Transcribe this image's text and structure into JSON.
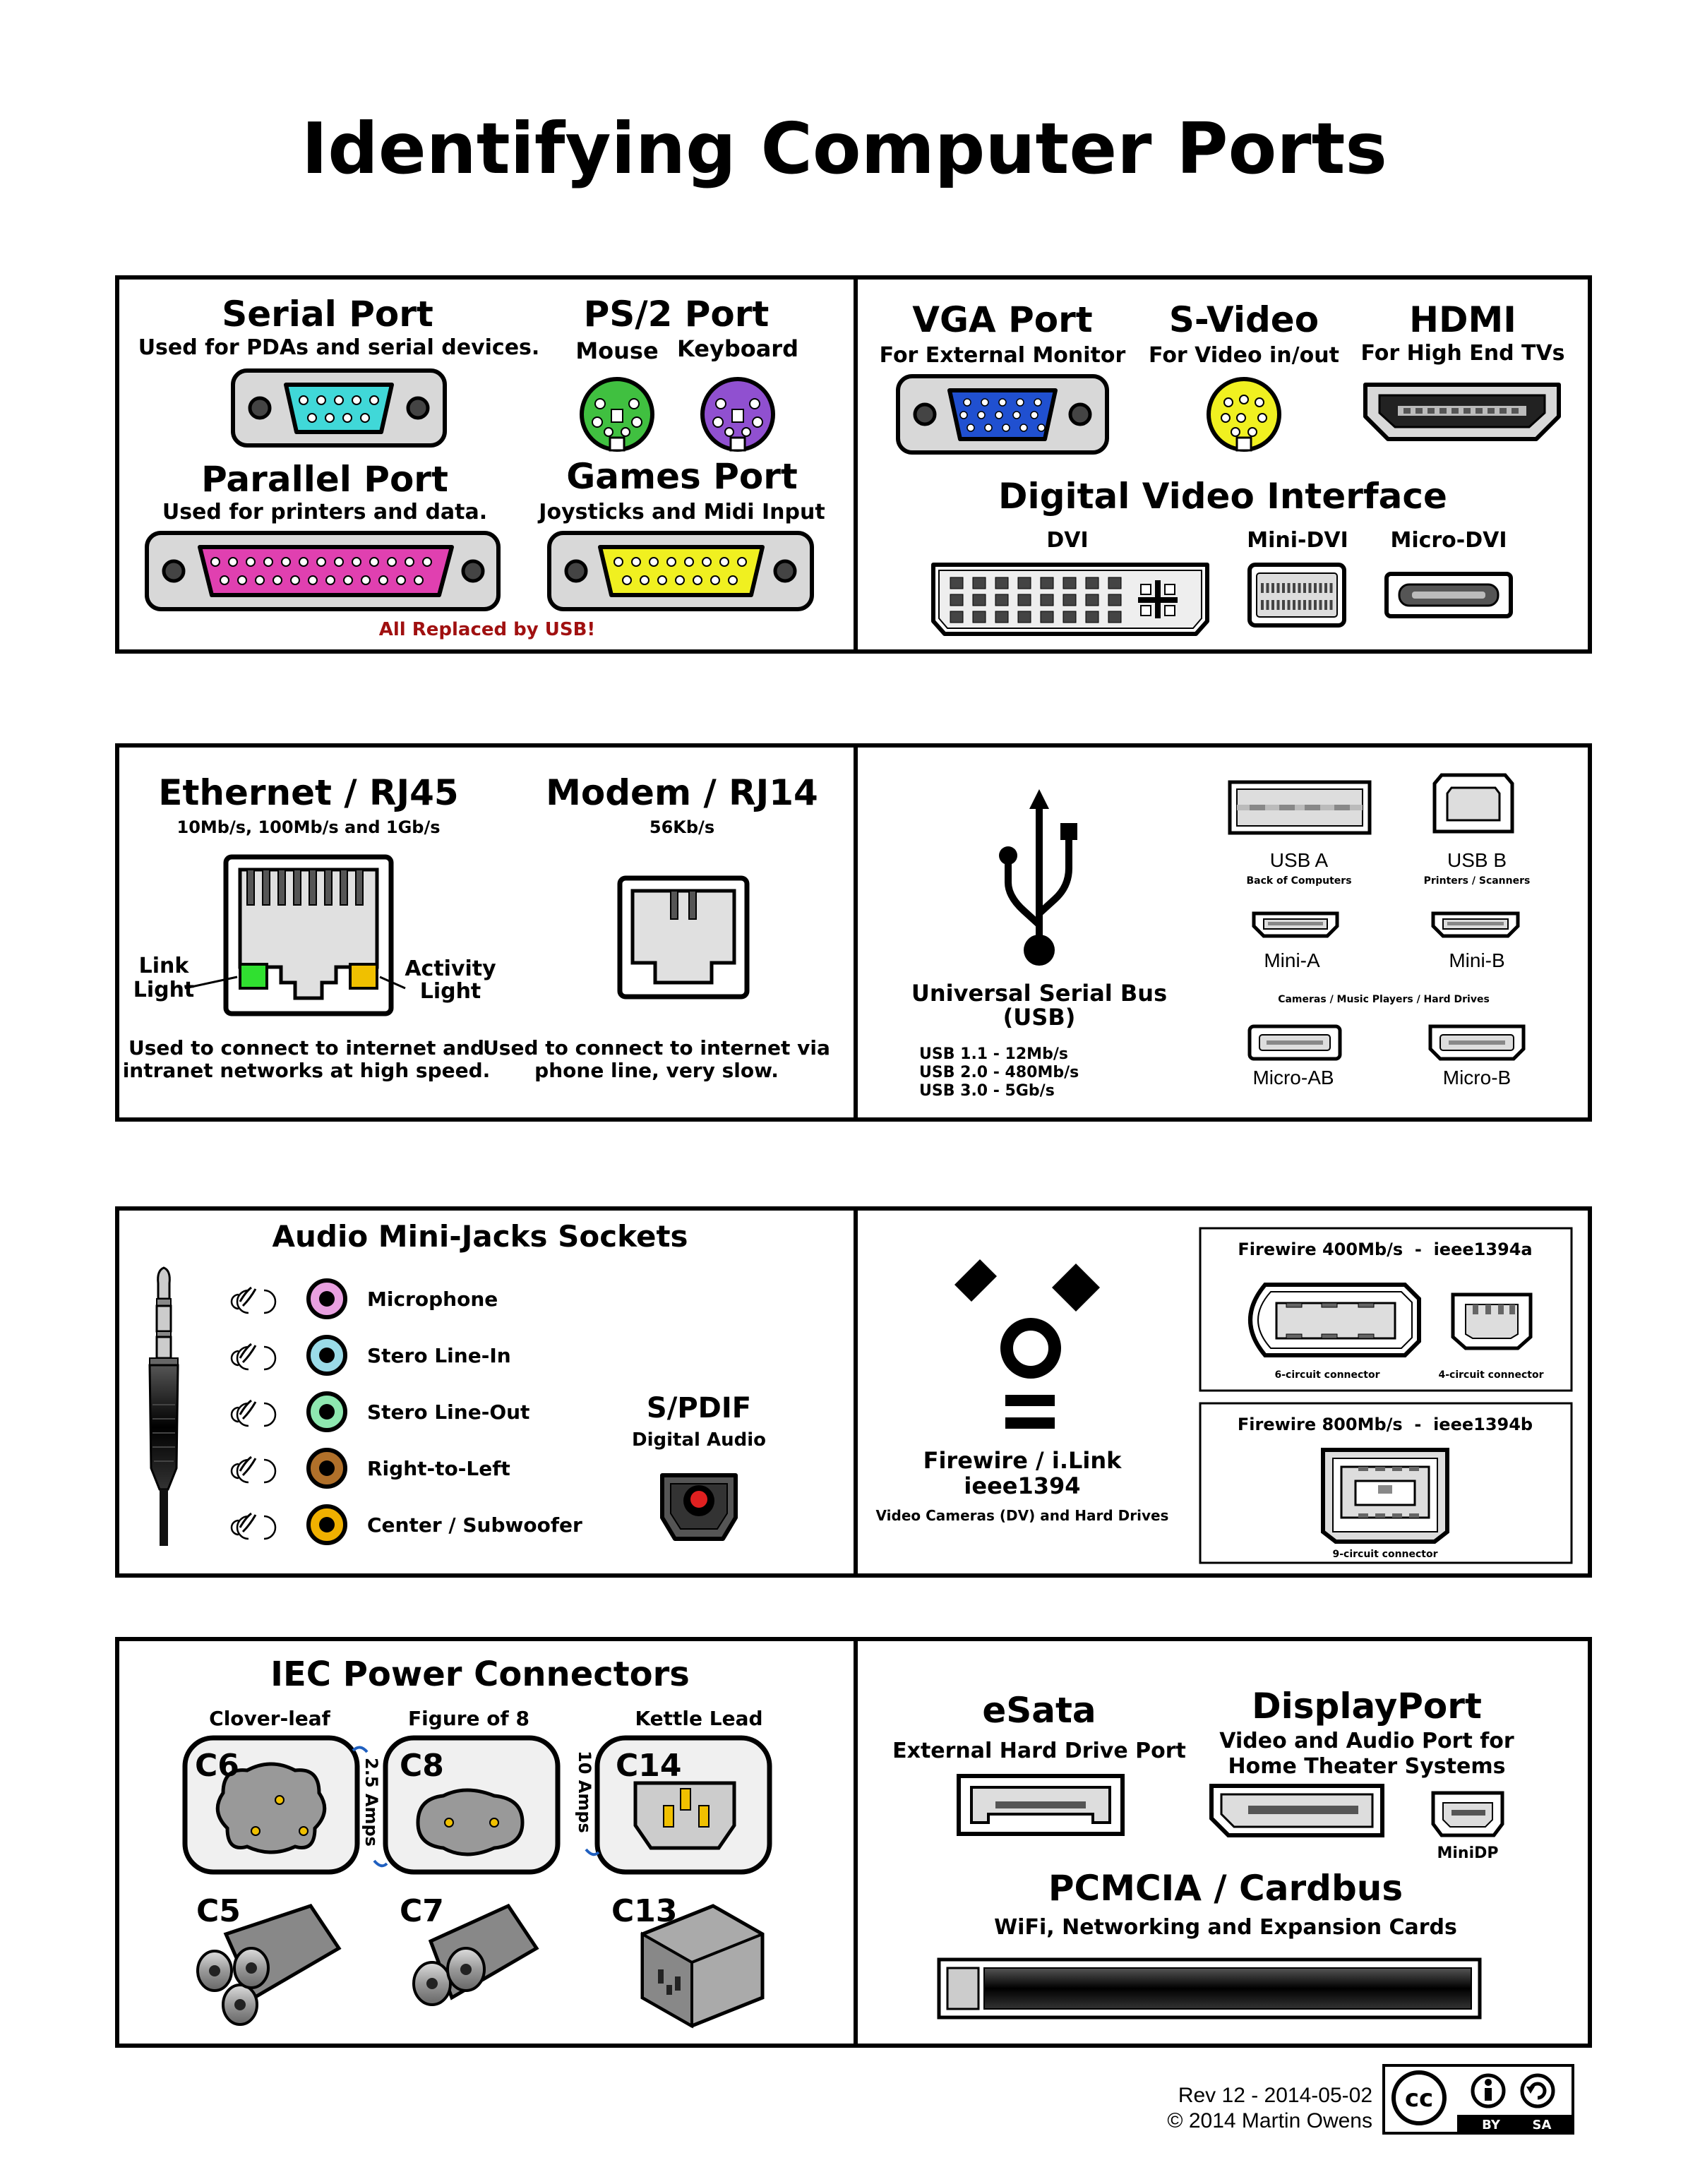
{
  "title": "Identifying Computer Ports",
  "legacy": {
    "serial": {
      "title": "Serial Port",
      "desc": "Used for PDAs and serial devices."
    },
    "ps2": {
      "title": "PS/2 Port",
      "mouse": "Mouse",
      "keyboard": "Keyboard"
    },
    "parallel": {
      "title": "Parallel Port",
      "desc": "Used for printers and data."
    },
    "games": {
      "title": "Games Port",
      "desc": "Joysticks and Midi Input"
    },
    "note": "All Replaced by USB!"
  },
  "video": {
    "vga": {
      "title": "VGA Port",
      "desc": "For External Monitor"
    },
    "svideo": {
      "title": "S-Video",
      "desc": "For Video in/out"
    },
    "hdmi": {
      "title": "HDMI",
      "desc": "For High End TVs"
    },
    "dvi_title": "Digital Video Interface",
    "dvi": "DVI",
    "mini_dvi": "Mini-DVI",
    "micro_dvi": "Micro-DVI"
  },
  "network": {
    "ethernet": {
      "title": "Ethernet / RJ45",
      "speeds": "10Mb/s, 100Mb/s and 1Gb/s",
      "link1": "Link",
      "link2": "Light",
      "act1": "Activity",
      "act2": "Light",
      "desc1": "Used to connect to internet and",
      "desc2": "intranet networks at high speed."
    },
    "modem": {
      "title": "Modem / RJ14",
      "speed": "56Kb/s",
      "desc1": "Used to connect to internet via",
      "desc2": "phone line, very slow."
    }
  },
  "usb": {
    "title1": "Universal Serial Bus",
    "title2": "(USB)",
    "speeds": [
      "USB 1.1 - 12Mb/s",
      "USB 2.0 - 480Mb/s",
      "USB 3.0 - 5Gb/s"
    ],
    "usb_a": "USB A",
    "usb_a_sub": "Back of Computers",
    "usb_b": "USB B",
    "usb_b_sub": "Printers / Scanners",
    "mini_a": "Mini-A",
    "mini_b": "Mini-B",
    "mini_sub": "Cameras / Music Players / Hard Drives",
    "micro_ab": "Micro-AB",
    "micro_b": "Micro-B"
  },
  "audio": {
    "title": "Audio Mini-Jacks Sockets",
    "jacks": [
      {
        "label": "Microphone",
        "color": "#e8a0e0"
      },
      {
        "label": "Stero Line-In",
        "color": "#9adbe8"
      },
      {
        "label": "Stero Line-Out",
        "color": "#8ee8b0"
      },
      {
        "label": "Right-to-Left",
        "color": "#b0702a"
      },
      {
        "label": "Center / Subwoofer",
        "color": "#f0b000"
      }
    ],
    "spdif_title": "S/PDIF",
    "spdif_desc": "Digital Audio"
  },
  "firewire": {
    "title1": "Firewire / i.Link",
    "title2": "ieee1394",
    "desc": "Video Cameras (DV) and Hard Drives",
    "fw400": "Firewire 400Mb/s  -  ieee1394a",
    "six": "6-circuit connector",
    "four": "4-circuit connector",
    "fw800": "Firewire 800Mb/s  -  ieee1394b",
    "nine": "9-circuit connector"
  },
  "power": {
    "title": "IEC Power Connectors",
    "cloverleaf": "Clover-leaf",
    "figure8": "Figure of 8",
    "kettle": "Kettle Lead",
    "c6": "C6",
    "c8": "C8",
    "c14": "C14",
    "amps25": "2.5 Amps",
    "amps10": "10 Amps",
    "c5": "C5",
    "c7": "C7",
    "c13": "C13"
  },
  "misc": {
    "esata": "eSata",
    "esata_desc": "External Hard Drive Port",
    "dp": "DisplayPort",
    "dp_desc1": "Video and Audio Port for",
    "dp_desc2": "Home Theater Systems",
    "minidp": "MiniDP",
    "pcmcia": "PCMCIA / Cardbus",
    "pcmcia_desc": "WiFi, Networking and Expansion Cards"
  },
  "footer": {
    "rev": "Rev 12 - 2014-05-02",
    "copy": "© 2014 Martin Owens",
    "cc": "cc",
    "by": "BY",
    "sa": "SA"
  },
  "colors": {
    "serial": "#40d8d8",
    "ps2_mouse": "#40c040",
    "ps2_kb": "#9050d0",
    "parallel": "#e040b0",
    "games": "#f0f020",
    "vga": "#2050d0",
    "svideo": "#f0f020",
    "link": "#30e030",
    "activity": "#f0c000",
    "note": "#a01010",
    "grey": "#d8d8d8"
  }
}
